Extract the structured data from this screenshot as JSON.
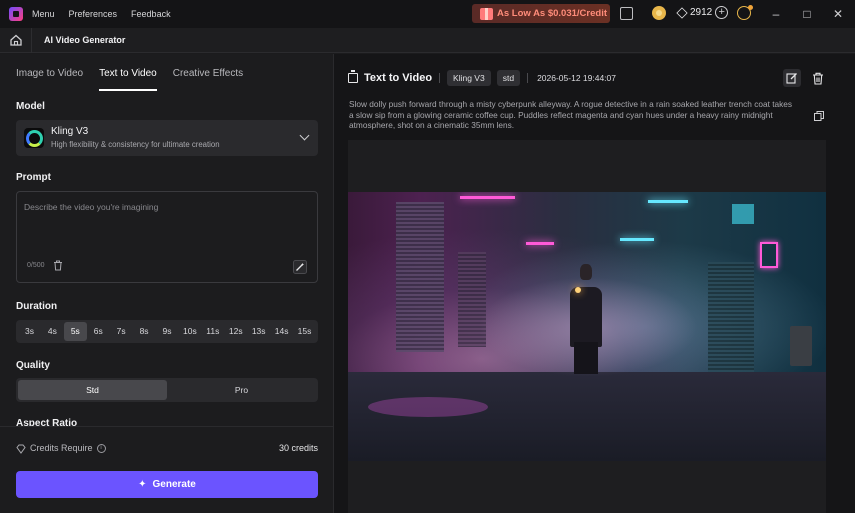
{
  "titlebar": {
    "menu": [
      "Menu",
      "Preferences",
      "Feedback"
    ],
    "promo_text": "As Low As $0.031/Credit",
    "gem_count": "2912",
    "window_controls": [
      "minimize-icon",
      "maximize-icon",
      "close-icon"
    ]
  },
  "subheader": {
    "title": "AI Video Generator"
  },
  "left": {
    "tabs": [
      {
        "label": "Image to Video",
        "active": false
      },
      {
        "label": "Text to Video",
        "active": true
      },
      {
        "label": "Creative Effects",
        "active": false
      }
    ],
    "model": {
      "section_label": "Model",
      "name": "Kling V3",
      "description": "High flexibility & consistency for ultimate creation"
    },
    "prompt": {
      "section_label": "Prompt",
      "placeholder": "Describe the video you're imagining",
      "value": "",
      "char_count": "0/500"
    },
    "duration": {
      "section_label": "Duration",
      "options": [
        "3s",
        "4s",
        "5s",
        "6s",
        "7s",
        "8s",
        "9s",
        "10s",
        "11s",
        "12s",
        "13s",
        "14s",
        "15s"
      ],
      "selected": "5s"
    },
    "quality": {
      "section_label": "Quality",
      "options": [
        "Std",
        "Pro"
      ],
      "selected": "Std"
    },
    "aspect_ratio": {
      "section_label": "Aspect Ratio"
    },
    "credits": {
      "label": "Credits Require",
      "value": "30 credits"
    },
    "generate_label": "Generate"
  },
  "right": {
    "title": "Text to Video",
    "model_chip": "Kling V3",
    "quality_chip": "std",
    "date": "2026-05-12 19:44:07",
    "description": "Slow dolly push forward through a misty cyberpunk alleyway. A rogue detective in a rain soaked leather trench coat takes a slow sip from a glowing ceramic coffee cup. Puddles reflect magenta and cyan hues under a heavy rainy midnight atmosphere, shot on a cinematic 35mm lens."
  },
  "colors": {
    "accent": "#6b54ff",
    "promo_text": "#ff8c7a",
    "bg_panel": "#1c1c1e",
    "bg_right": "#151517"
  }
}
